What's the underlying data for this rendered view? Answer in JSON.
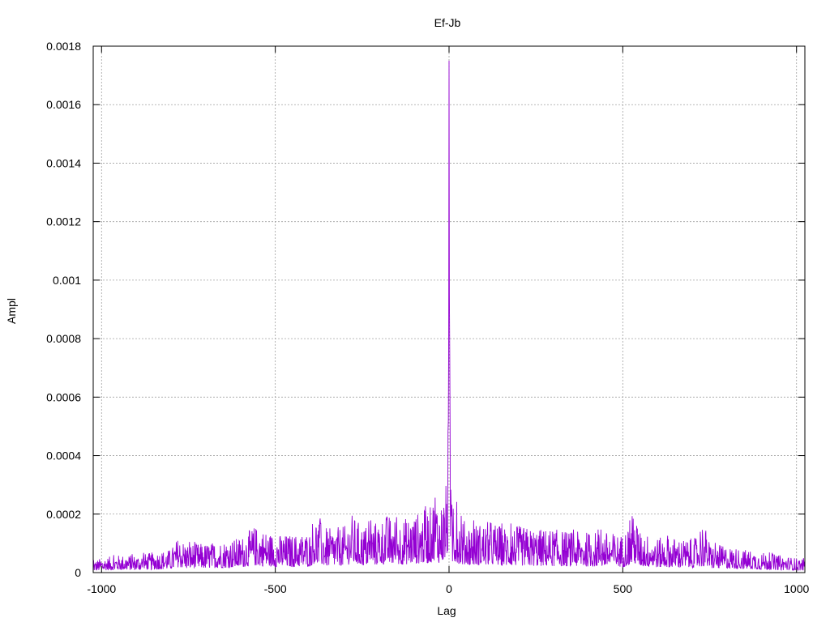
{
  "chart_data": {
    "type": "line",
    "title": "Ef-Jb",
    "xlabel": "Lag",
    "ylabel": "Ampl",
    "xlim": [
      -1024,
      1024
    ],
    "ylim": [
      0,
      0.0018
    ],
    "xticks": [
      -1000,
      -500,
      0,
      500,
      1000
    ],
    "xtick_labels": [
      "-1000",
      "-500",
      "0",
      "500",
      "1000"
    ],
    "yticks": [
      0,
      0.0002,
      0.0004,
      0.0006,
      0.0008,
      0.001,
      0.0012,
      0.0014,
      0.0016,
      0.0018
    ],
    "ytick_labels": [
      "0",
      "0.0002",
      "0.0004",
      "0.0006",
      "0.0008",
      "0.001",
      "0.0012",
      "0.0014",
      "0.0016",
      "0.0018"
    ],
    "grid": true,
    "line_color": "#9400d3",
    "series": [
      {
        "x": [
          -1024,
          -1000,
          -950,
          -900,
          -850,
          -800,
          -780,
          -750,
          -700,
          -650,
          -600,
          -560,
          -500,
          -450,
          -400,
          -390,
          -350,
          -300,
          -280,
          -250,
          -200,
          -180,
          -150,
          -120,
          -100,
          -80,
          -60,
          -50,
          -40,
          -30,
          -20,
          -10,
          -5,
          -2,
          -1,
          0,
          1,
          2,
          3,
          5,
          10,
          20,
          30,
          40,
          50,
          60,
          80,
          100,
          120,
          150,
          200,
          250,
          300,
          350,
          400,
          450,
          500,
          535,
          550,
          600,
          650,
          700,
          740,
          750,
          800,
          850,
          900,
          950,
          1000,
          1024
        ],
        "y": [
          4e-05,
          5e-05,
          6e-05,
          6e-05,
          7e-05,
          8e-05,
          0.00012,
          0.0001,
          0.0001,
          0.00011,
          0.00012,
          0.00016,
          0.00013,
          0.00013,
          0.00014,
          0.0002,
          0.00015,
          0.00016,
          0.0002,
          0.00016,
          0.00018,
          0.0002,
          0.00018,
          0.00019,
          0.0002,
          0.00021,
          0.00022,
          0.00023,
          0.0003,
          0.00022,
          0.00025,
          0.00028,
          0.0004,
          0.00052,
          0.0008,
          0.00175,
          0.00095,
          0.00075,
          0.0005,
          0.0003,
          0.0002,
          0.00024,
          0.00019,
          0.00018,
          0.00018,
          0.00017,
          0.00017,
          0.00017,
          0.00018,
          0.00016,
          0.00016,
          0.00015,
          0.00015,
          0.00014,
          0.00014,
          0.00014,
          0.00013,
          0.0002,
          0.00014,
          0.00012,
          0.00012,
          0.00011,
          0.00015,
          0.0001,
          9e-05,
          8e-05,
          7e-05,
          6e-05,
          5e-05,
          5e-05
        ]
      }
    ]
  }
}
